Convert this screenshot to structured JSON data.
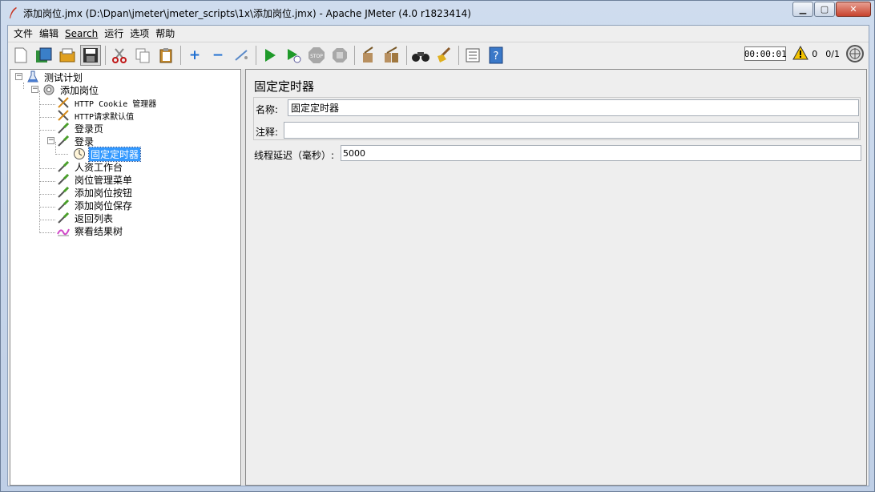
{
  "window": {
    "title": "添加岗位.jmx (D:\\Dpan\\jmeter\\jmeter_scripts\\1x\\添加岗位.jmx) - Apache JMeter (4.0 r1823414)"
  },
  "menu": {
    "items": [
      "文件",
      "编辑",
      "Search",
      "运行",
      "选项",
      "帮助"
    ]
  },
  "toolbar": {
    "buttons": [
      {
        "icon": "new-icon"
      },
      {
        "icon": "templates-icon"
      },
      {
        "icon": "open-icon"
      },
      {
        "icon": "save-icon"
      },
      {
        "icon": "cut-icon"
      },
      {
        "icon": "copy-icon"
      },
      {
        "icon": "paste-icon"
      },
      {
        "icon": "expand-icon"
      },
      {
        "icon": "collapse-icon"
      },
      {
        "icon": "toggle-icon"
      },
      {
        "icon": "start-icon"
      },
      {
        "icon": "start-no-timers-icon"
      },
      {
        "icon": "stop-icon"
      },
      {
        "icon": "shutdown-icon"
      },
      {
        "icon": "clear-icon"
      },
      {
        "icon": "clear-all-icon"
      },
      {
        "icon": "search-icon"
      },
      {
        "icon": "reset-search-icon"
      },
      {
        "icon": "function-helper-icon"
      },
      {
        "icon": "help-icon"
      }
    ],
    "timer": "00:00:01",
    "warning_count": "0",
    "thread_count": "0/1"
  },
  "tree": {
    "nodes": [
      {
        "label": "测试计划",
        "level": 0,
        "icon": "test-plan-icon"
      },
      {
        "label": "添加岗位",
        "level": 1,
        "icon": "thread-group-icon"
      },
      {
        "label": "HTTP Cookie 管理器",
        "level": 2,
        "icon": "config-element-icon"
      },
      {
        "label": "HTTP请求默认值",
        "level": 2,
        "icon": "config-element-icon"
      },
      {
        "label": "登录页",
        "level": 2,
        "icon": "sampler-icon"
      },
      {
        "label": "登录",
        "level": 2,
        "icon": "sampler-icon"
      },
      {
        "label": "固定定时器",
        "level": 3,
        "icon": "timer-icon",
        "selected": true
      },
      {
        "label": "人资工作台",
        "level": 2,
        "icon": "sampler-icon"
      },
      {
        "label": "岗位管理菜单",
        "level": 2,
        "icon": "sampler-icon"
      },
      {
        "label": "添加岗位按钮",
        "level": 2,
        "icon": "sampler-icon"
      },
      {
        "label": "添加岗位保存",
        "level": 2,
        "icon": "sampler-icon"
      },
      {
        "label": "返回列表",
        "level": 2,
        "icon": "sampler-icon"
      },
      {
        "label": "察看结果树",
        "level": 2,
        "icon": "listener-icon"
      }
    ]
  },
  "panel": {
    "title": "固定定时器",
    "name_label": "名称:",
    "name_value": "固定定时器",
    "comment_label": "注释:",
    "comment_value": "",
    "delay_label": "线程延迟（毫秒）:",
    "delay_value": "5000"
  }
}
